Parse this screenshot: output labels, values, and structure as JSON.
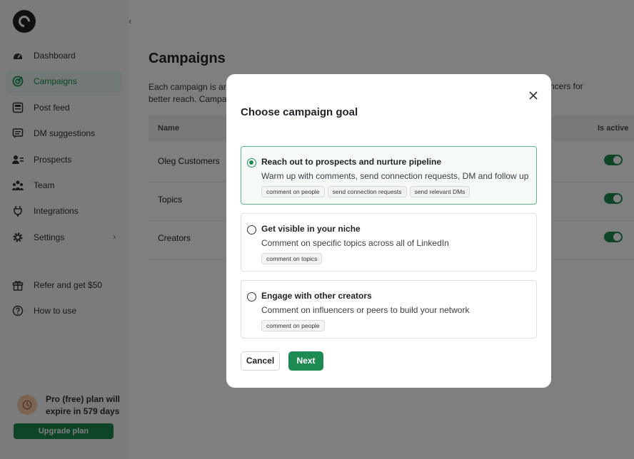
{
  "sidebar": {
    "items": [
      {
        "label": "Dashboard",
        "icon": "dashboard-icon"
      },
      {
        "label": "Campaigns",
        "icon": "campaigns-icon",
        "active": true
      },
      {
        "label": "Post feed",
        "icon": "post-feed-icon"
      },
      {
        "label": "DM suggestions",
        "icon": "dm-icon"
      },
      {
        "label": "Prospects",
        "icon": "prospects-icon"
      },
      {
        "label": "Team",
        "icon": "team-icon"
      },
      {
        "label": "Integrations",
        "icon": "plug-icon"
      },
      {
        "label": "Settings",
        "icon": "gear-icon"
      }
    ],
    "bottom_items": [
      {
        "label": "Refer and get $50",
        "icon": "gift-icon"
      },
      {
        "label": "How to use",
        "icon": "help-icon"
      }
    ],
    "plan_text": "Pro (free) plan will expire in 579 days",
    "upgrade_label": "Upgrade plan"
  },
  "main": {
    "title": "Campaigns",
    "description_left": "Each campaign is an e",
    "description_left2": "better reach. Campai",
    "description_right": "ncers for",
    "table": {
      "headers": {
        "name": "Name",
        "active": "Is active"
      },
      "rows": [
        {
          "name": "Oleg Customers",
          "active": true
        },
        {
          "name": "Topics",
          "active": true
        },
        {
          "name": "Creators",
          "active": true
        }
      ]
    }
  },
  "modal": {
    "title": "Choose campaign goal",
    "options": [
      {
        "title": "Reach out to prospects and nurture pipeline",
        "description": "Warm up with comments, send connection requests, DM and follow up",
        "tags": [
          "comment on people",
          "send connection requests",
          "send relevant DMs"
        ],
        "selected": true
      },
      {
        "title": "Get visible in your niche",
        "description": "Comment on specific topics across all of LinkedIn",
        "tags": [
          "comment on topics"
        ],
        "selected": false
      },
      {
        "title": "Engage with other creators",
        "description": "Comment on influencers or peers to build your network",
        "tags": [
          "comment on people"
        ],
        "selected": false
      }
    ],
    "cancel_label": "Cancel",
    "next_label": "Next"
  },
  "colors": {
    "accent": "#1c8a52",
    "overlay": "rgba(0,0,0,0.5)"
  }
}
